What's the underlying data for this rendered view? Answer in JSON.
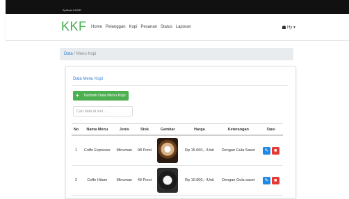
{
  "app": {
    "window_title": "Aplikasi KASIR"
  },
  "navbar": {
    "brand": "KKF",
    "menu": [
      "Home",
      "Pelanggan",
      "Kopi",
      "Pesanan",
      "Status",
      "Laporan"
    ],
    "user_label": "Hy"
  },
  "breadcrumb": {
    "link": "Data",
    "separator": "/",
    "current": "Menu Kopi"
  },
  "card": {
    "title": "Data Menu Kopi",
    "add_button": "Tambah Data Menu Kopi",
    "search_placeholder": "Cari data di sini..."
  },
  "table": {
    "headers": [
      "No",
      "Nama Menu",
      "Jenis",
      "Stok",
      "Gambar",
      "Harga",
      "Keterangan",
      "Opsi"
    ],
    "rows": [
      {
        "no": "1",
        "nama": "Coffe Expresso",
        "jenis": "Minuman",
        "stok": "98 Porsi",
        "harga": "Rp 15.000,- /Unit",
        "keterangan": "Dengan Gula Saset"
      },
      {
        "no": "2",
        "nama": "Coffe Hitam",
        "jenis": "Minuman",
        "stok": "49 Porsi",
        "harga": "Rp 10.000,- /Unit",
        "keterangan": "Dengan Gula saset"
      }
    ]
  },
  "icons": {
    "edit": "pencil-icon",
    "delete": "trash-icon",
    "add": "plus-icon",
    "user": "user-icon"
  },
  "colors": {
    "brand": "#3fae49",
    "link": "#2f7fd1",
    "add_button": "#4caf50",
    "edit": "#1e88e5",
    "delete": "#e53935"
  }
}
